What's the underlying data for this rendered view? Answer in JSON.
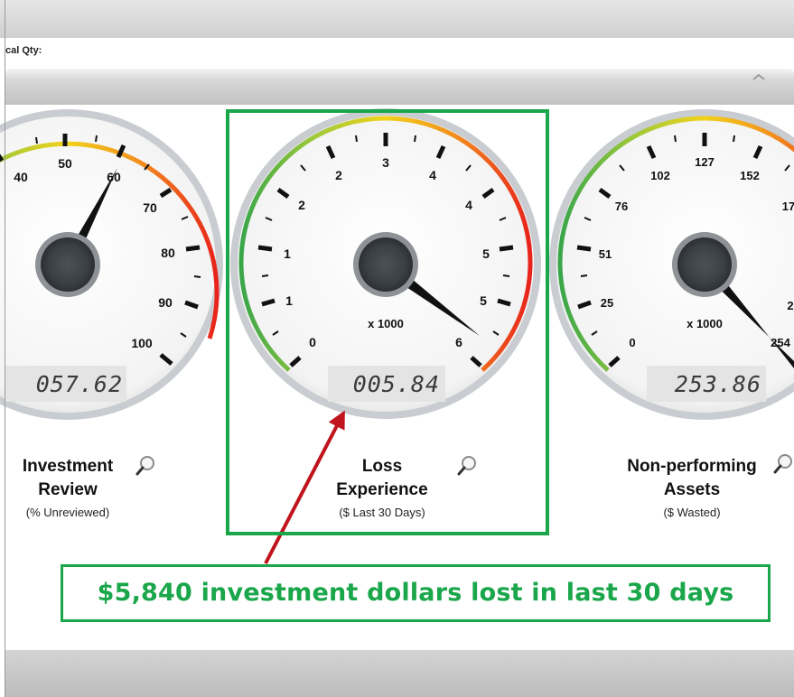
{
  "toolbar": {
    "qty_label": "cal Qty:"
  },
  "gauges": [
    {
      "id": "investment-review",
      "value": 57.62,
      "display": "057.62",
      "ticks": [
        "40",
        "50",
        "60",
        "70",
        "80",
        "90",
        "100"
      ],
      "multiplier": "",
      "title_line1": "Investment",
      "title_line2": "Review",
      "subtitle": "(% Unreviewed)"
    },
    {
      "id": "loss-experience",
      "value": 5.84,
      "display": "005.84",
      "ticks": [
        "0",
        "1",
        "1",
        "2",
        "2",
        "3",
        "4",
        "4",
        "5",
        "5",
        "6"
      ],
      "multiplier": "x 1000",
      "title_line1": "Loss",
      "title_line2": "Experience",
      "subtitle": "($ Last 30 Days)"
    },
    {
      "id": "non-performing-assets",
      "value": 253.86,
      "display": "253.86",
      "ticks": [
        "0",
        "25",
        "51",
        "76",
        "102",
        "127",
        "152",
        "17",
        "2",
        "254"
      ],
      "multiplier": "x 1000",
      "title_line1": "Non-performing",
      "title_line2": "Assets",
      "subtitle": "($ Wasted)"
    }
  ],
  "callout": {
    "text": "$5,840 investment dollars lost in last 30 days"
  },
  "colors": {
    "highlight": "#1aa64a",
    "arrow": "#c0141c",
    "needle": "#111111",
    "gauge_green": "#3aa64a",
    "gauge_yellow": "#f2d21b",
    "gauge_red": "#e8231c"
  },
  "icons": {
    "magnify": "magnifying-glass-icon"
  }
}
